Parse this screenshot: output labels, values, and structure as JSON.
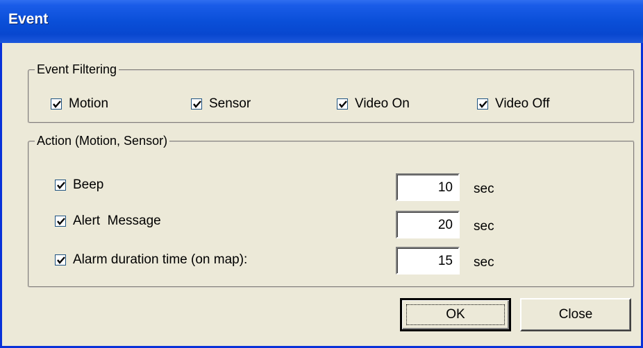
{
  "window": {
    "title": "Event"
  },
  "event_filtering": {
    "legend": "Event Filtering",
    "items": [
      {
        "label": "Motion",
        "checked": true
      },
      {
        "label": "Sensor",
        "checked": true
      },
      {
        "label": "Video On",
        "checked": true
      },
      {
        "label": "Video Off",
        "checked": true
      }
    ]
  },
  "action": {
    "legend": "Action (Motion, Sensor)",
    "items": [
      {
        "label": "Beep",
        "checked": true,
        "value": "10",
        "unit": "sec"
      },
      {
        "label": "Alert  Message",
        "checked": true,
        "value": "20",
        "unit": "sec"
      },
      {
        "label": "Alarm duration time (on map):",
        "checked": true,
        "value": "15",
        "unit": "sec"
      }
    ]
  },
  "buttons": {
    "ok": "OK",
    "close": "Close"
  }
}
